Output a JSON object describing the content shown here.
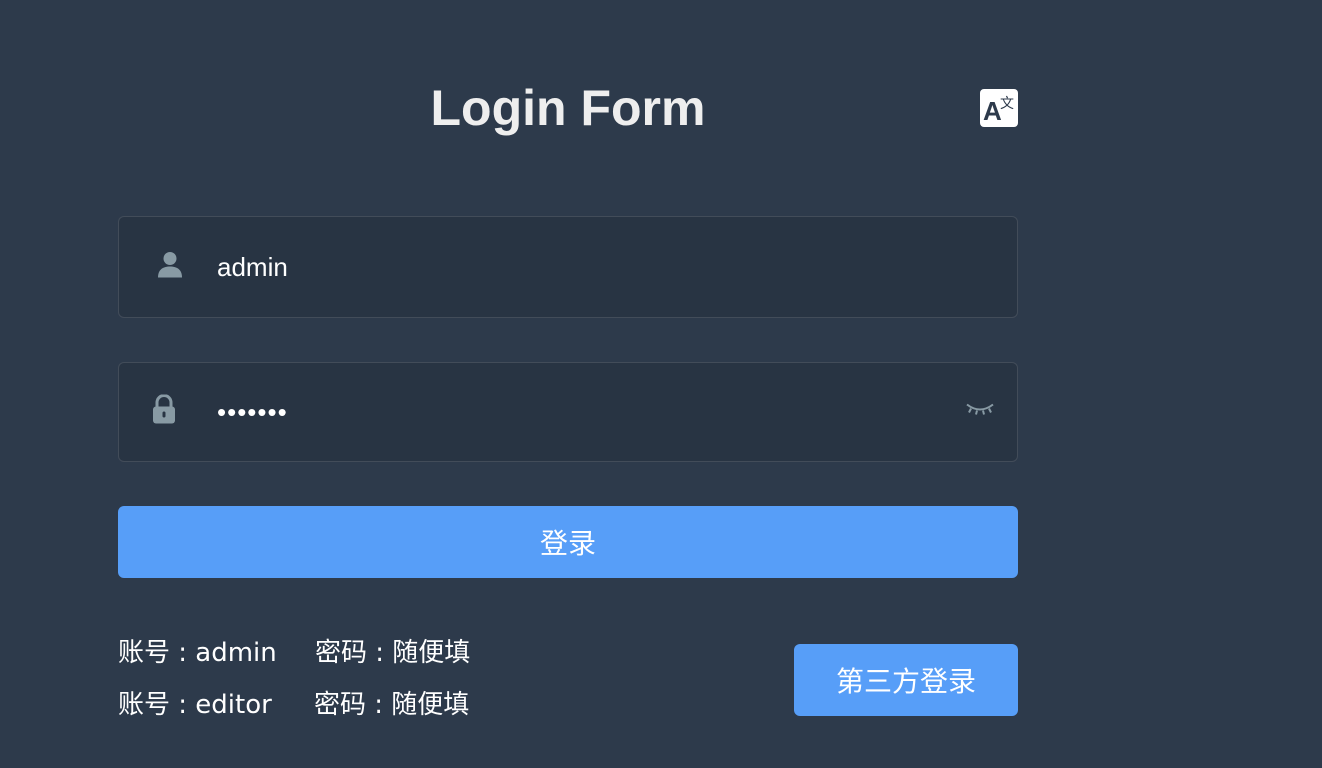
{
  "form": {
    "title": "Login Form",
    "language_icon": "translate-icon",
    "username": {
      "icon": "user-icon",
      "value": "admin"
    },
    "password": {
      "icon": "lock-icon",
      "value": "•••••••",
      "toggle_icon": "eye-closed-icon"
    },
    "login_button": "登录",
    "tips": [
      {
        "account": "账号 : admin",
        "password": "密码 : 随便填"
      },
      {
        "account": "账号 : editor",
        "password": "密码 : 随便填"
      }
    ],
    "third_party_button": "第三方登录"
  },
  "colors": {
    "background": "#2d3a4b",
    "input_background": "#283443",
    "accent": "#579ef8",
    "title": "#eeeeee",
    "icon": "#889aa4"
  }
}
